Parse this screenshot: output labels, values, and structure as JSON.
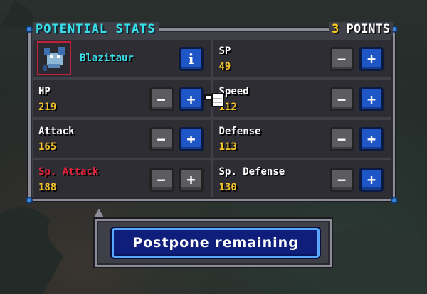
{
  "panel": {
    "title": "POTENTIAL STATS",
    "points_value": "3",
    "points_label": "POINTS"
  },
  "pokemon": {
    "name": "Blazitaur",
    "info_label": "i",
    "icon": "pokemon-portrait-icon"
  },
  "stats": {
    "sp": {
      "label": "SP",
      "value": "49"
    },
    "hp": {
      "label": "HP",
      "value": "219"
    },
    "speed": {
      "label": "Speed",
      "value": "112"
    },
    "attack": {
      "label": "Attack",
      "value": "165"
    },
    "defense": {
      "label": "Defense",
      "value": "113"
    },
    "sp_attack": {
      "label": "Sp. Attack",
      "value": "188"
    },
    "sp_defense": {
      "label": "Sp. Defense",
      "value": "130"
    }
  },
  "buttons": {
    "minus": "−",
    "plus": "+"
  },
  "dialog": {
    "postpone_label": "Postpone remaining"
  },
  "colors": {
    "title": "#38e0ea",
    "value": "#f3c22a",
    "highlight_stat": "#e0233a",
    "plus_button": "#1e56c8"
  }
}
